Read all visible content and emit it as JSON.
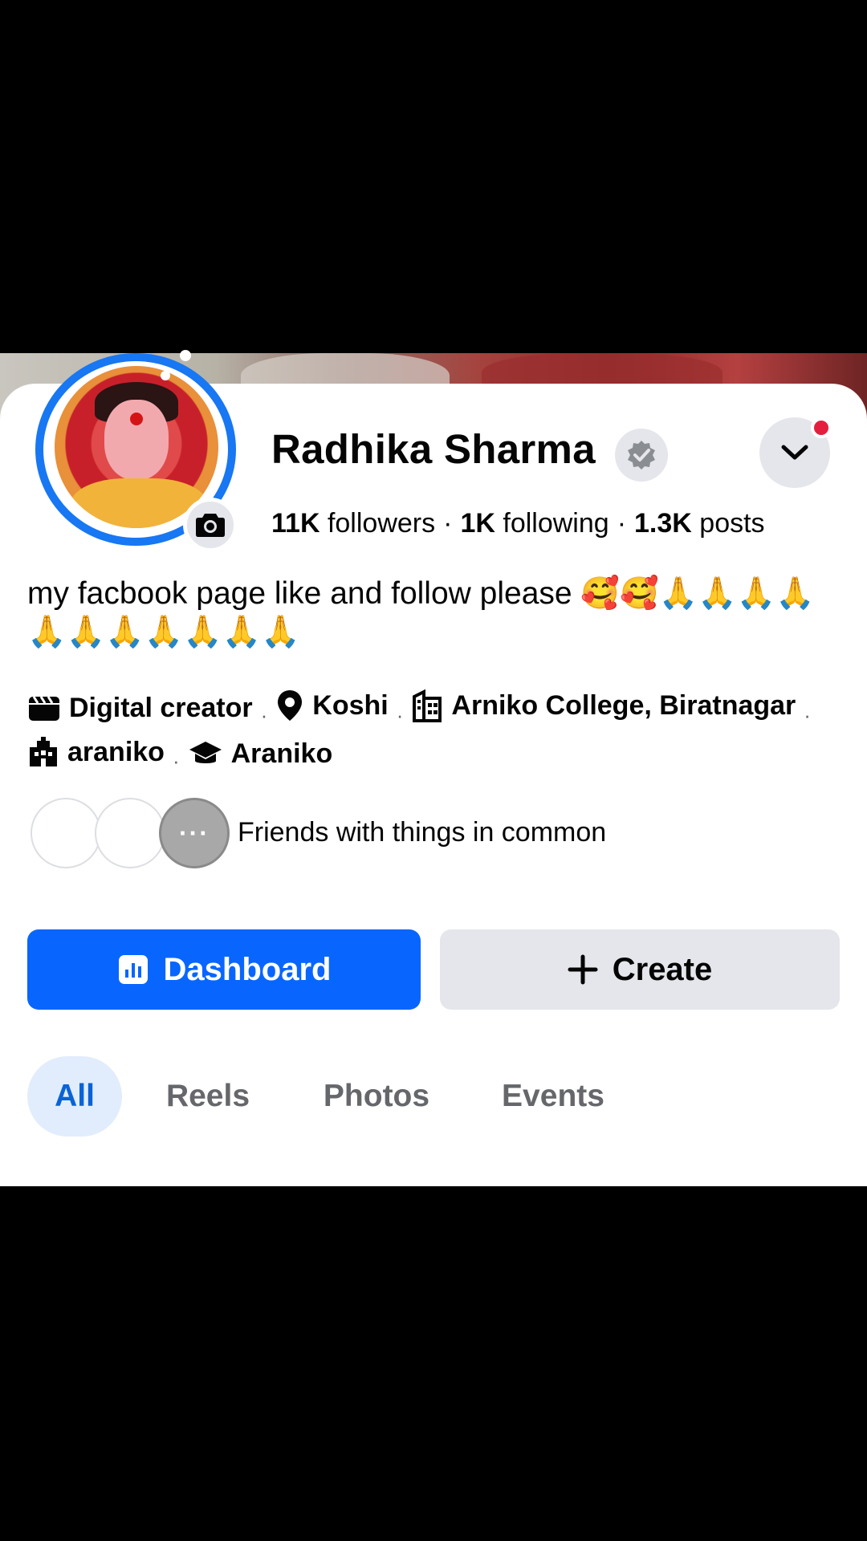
{
  "profile": {
    "name": "Radhika Sharma",
    "followers_count": "11K",
    "followers_label": "followers",
    "following_count": "1K",
    "following_label": "following",
    "posts_count": "1.3K",
    "posts_label": "posts",
    "separator": "·",
    "bio": "my facbook page like and follow  please 🥰🥰🙏🙏🙏🙏🙏🙏🙏🙏🙏🙏🙏"
  },
  "details": {
    "category": "Digital creator",
    "location": "Koshi",
    "college": "Arniko College, Biratnagar",
    "work": "araniko",
    "education": "Araniko"
  },
  "mutual": {
    "more_glyph": "···",
    "label": "Friends with things in common"
  },
  "actions": {
    "dashboard_label": "Dashboard",
    "create_label": "Create"
  },
  "tabs": {
    "all": "All",
    "reels": "Reels",
    "photos": "Photos",
    "events": "Events"
  },
  "colors": {
    "brand_blue": "#0866ff",
    "ring_blue": "#1877f2",
    "notification_red": "#e41e3f",
    "active_tab_bg": "#e1edfc"
  },
  "icons": [
    "camera-icon",
    "verified-badge-icon",
    "chevron-down-icon",
    "clapperboard-icon",
    "location-pin-icon",
    "building-icon",
    "workplace-icon",
    "graduation-cap-icon",
    "bar-chart-icon",
    "plus-icon"
  ]
}
